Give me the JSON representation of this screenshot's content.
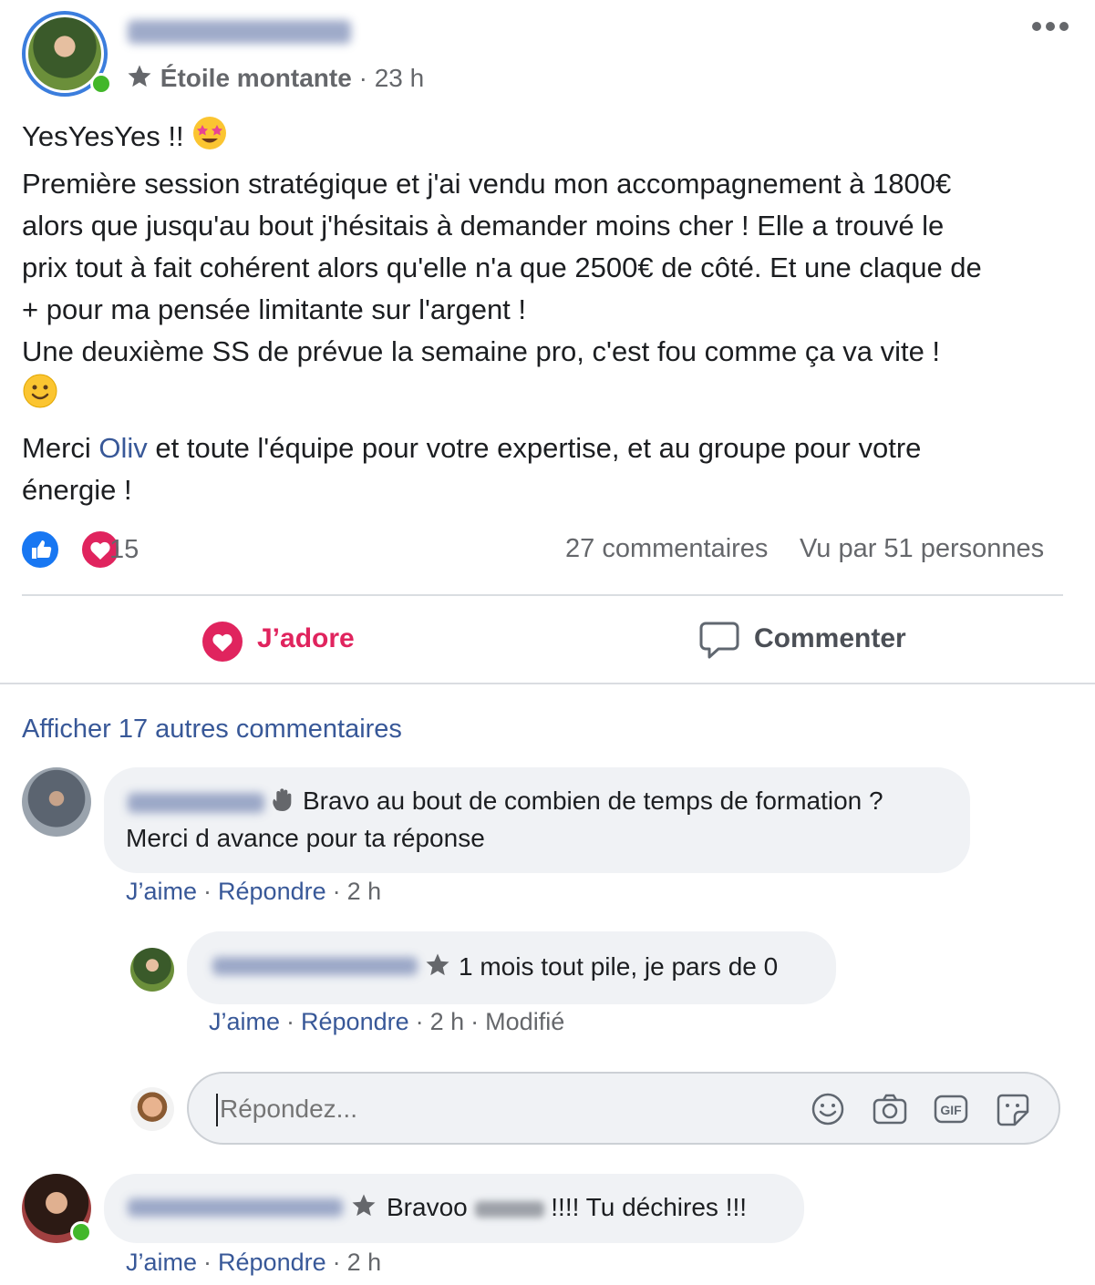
{
  "post": {
    "badge": "Étoile montante",
    "time": "23 h",
    "text": {
      "line1": "YesYesYes !! ",
      "line2": "Première session stratégique et j'ai vendu mon accompagnement à 1800€",
      "line3": "alors que jusqu'au bout j'hésitais à demander moins cher ! Elle a trouvé le",
      "line4": "prix tout à fait cohérent alors qu'elle n'a que 2500€ de côté. Et une claque de",
      "line5": "+ pour ma pensée limitante sur l'argent !",
      "line6": "Une deuxième SS de prévue la semaine pro, c'est fou comme ça va vite !",
      "thanks_pre": "Merci ",
      "mention": "Oliv",
      "thanks_post": " et toute l'équipe pour votre expertise, et au groupe pour votre",
      "thanks_line2": "énergie !"
    },
    "reactions_count": "15",
    "comments_count": "27 commentaires",
    "seen_by": "Vu par 51 personnes",
    "actions": {
      "love": "J’adore",
      "comment": "Commenter"
    }
  },
  "comments": {
    "more_link": "Afficher 17 autres commentaires",
    "c1": {
      "text1": "Bravo au bout de combien de temps de formation ?",
      "text2": "Merci d avance pour ta réponse",
      "like": "J’aime",
      "reply": "Répondre",
      "time": "2 h"
    },
    "r1": {
      "text": "1 mois tout pile, je pars de 0",
      "like": "J’aime",
      "reply": "Répondre",
      "time": "2 h",
      "edited": "Modifié"
    },
    "reply_box": {
      "placeholder": "Répondez..."
    },
    "c2": {
      "text_pre": "Bravoo ",
      "text_post": " !!!! Tu déchires !!!",
      "like": "J’aime",
      "reply": "Répondre",
      "time": "2 h"
    }
  },
  "colors": {
    "link": "#385898",
    "love": "#e0245e",
    "like": "#1877f2",
    "online": "#42b72a",
    "bubble": "#f0f2f5"
  },
  "icons": [
    "more-icon",
    "star-badge-icon",
    "star-struck-emoji",
    "smile-emoji",
    "like-reaction-icon",
    "love-reaction-icon",
    "comment-icon",
    "wave-icon",
    "emoji-icon",
    "camera-icon",
    "gif-icon",
    "sticker-icon"
  ]
}
